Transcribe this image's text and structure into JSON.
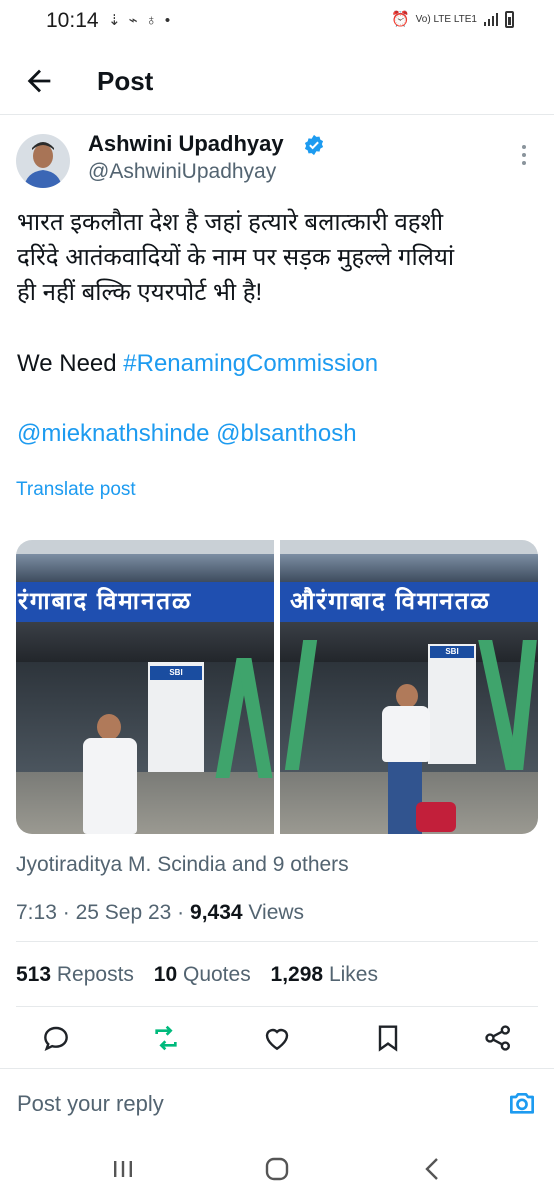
{
  "status_bar": {
    "time": "10:14",
    "left_icons": [
      "notification-icon",
      "data-icon",
      "gallery-icon",
      "dot-icon"
    ],
    "right_text": "Vo) LTE LTE1",
    "right_icons": [
      "alarm-icon",
      "signal-icon",
      "battery-icon"
    ]
  },
  "app_bar": {
    "back_icon": "arrow-left-icon",
    "title": "Post"
  },
  "post": {
    "author": {
      "name": "Ashwini Upadhyay",
      "handle": "@AshwiniUpadhyay",
      "verified": true,
      "verified_color": "#1d9bf0"
    },
    "text_lines": [
      "भारत इकलौता देश है जहां हत्यारे बलात्कारी वहशी",
      "दरिंदे आतंकवादियों के नाम पर सड़क मुहल्ले गलियां",
      "ही नहीं बल्कि एयरपोर्ट भी है!"
    ],
    "need_prefix": "We Need ",
    "hashtag": "#RenamingCommission",
    "mention_1": "@mieknathshinde",
    "mention_2": "@blsanthosh",
    "translate_label": "Translate post",
    "link_color": "#1d9bf0",
    "photos": [
      {
        "sign_text": "रंगाबाद  विमानतळ",
        "kiosk_label": "SBI"
      },
      {
        "sign_text": "औरंगाबाद  विमानतळ",
        "kiosk_label": "SBI"
      }
    ],
    "liked_by": "Jyotiraditya M. Scindia and 9 others",
    "time": "7:13",
    "date": "25 Sep 23",
    "sep": "·",
    "views_count": "9,434",
    "views_label": "Views",
    "reposts_count": "513",
    "reposts_label": "Reposts",
    "quotes_count": "10",
    "quotes_label": "Quotes",
    "likes_count": "1,298",
    "likes_label": "Likes"
  },
  "actions": {
    "icons": [
      "reply-icon",
      "repost-icon",
      "like-icon",
      "bookmark-icon",
      "share-icon"
    ],
    "repost_color": "#00ba7c"
  },
  "reply": {
    "placeholder": "Post your reply",
    "camera_icon": "camera-icon"
  },
  "nav_bar": {
    "icons": [
      "recents-icon",
      "home-icon",
      "back-icon"
    ]
  }
}
